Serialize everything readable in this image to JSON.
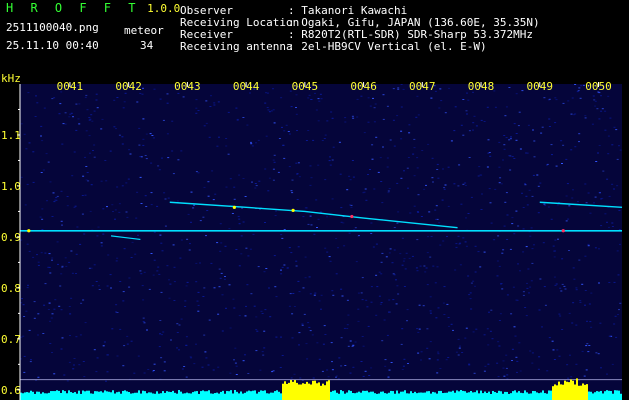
{
  "header": {
    "app_name": "H R O F F T",
    "version": "1.0.0",
    "filename": "2511100040.png",
    "datetime": "25.11.10 00:40",
    "meteor_label": "meteor",
    "meteor_count": "34",
    "info": [
      {
        "label": "Observer",
        "value": ": Takanori Kawachi"
      },
      {
        "label": "Receiving Location",
        "value": ": Ogaki, Gifu, JAPAN (136.60E, 35.35N)"
      },
      {
        "label": "Receiver",
        "value": ": R820T2(RTL-SDR) SDR-Sharp 53.372MHz"
      },
      {
        "label": "Receiving antenna",
        "value": ": 2el-HB9CV Vertical (el. E-W)"
      }
    ]
  },
  "chart_data": {
    "type": "heatmap",
    "ylabel": "kHz",
    "ylim": [
      0.58,
      1.2
    ],
    "y_ticks": [
      "1.1",
      "1.0",
      "0.9",
      "0.8",
      "0.7",
      "0.6"
    ],
    "y_tick_values": [
      1.1,
      1.0,
      0.9,
      0.8,
      0.7,
      0.6
    ],
    "x_ticks": [
      "0041",
      "0042",
      "0043",
      "0044",
      "0045",
      "0046",
      "0047",
      "0048",
      "0049",
      "0050"
    ],
    "xlim_minutes": [
      40.15,
      50.4
    ],
    "x_tick_minutes": [
      41,
      42,
      43,
      44,
      45,
      46,
      47,
      48,
      49,
      50
    ],
    "baseline_carrier_khz": 0.912,
    "grid_lines_khz": [
      0.62,
      0.59
    ],
    "colors": {
      "background": "#05053a",
      "noise_low": "#0a1a9a",
      "noise_high": "#3355ff",
      "signal": "#00e0ff",
      "hot": "#ffff00",
      "peak": "#ff3060",
      "tick_text": "#ffff33",
      "axis": "#ffffff",
      "activity_fill": "#00ffff",
      "activity_peak": "#ffff00"
    }
  }
}
